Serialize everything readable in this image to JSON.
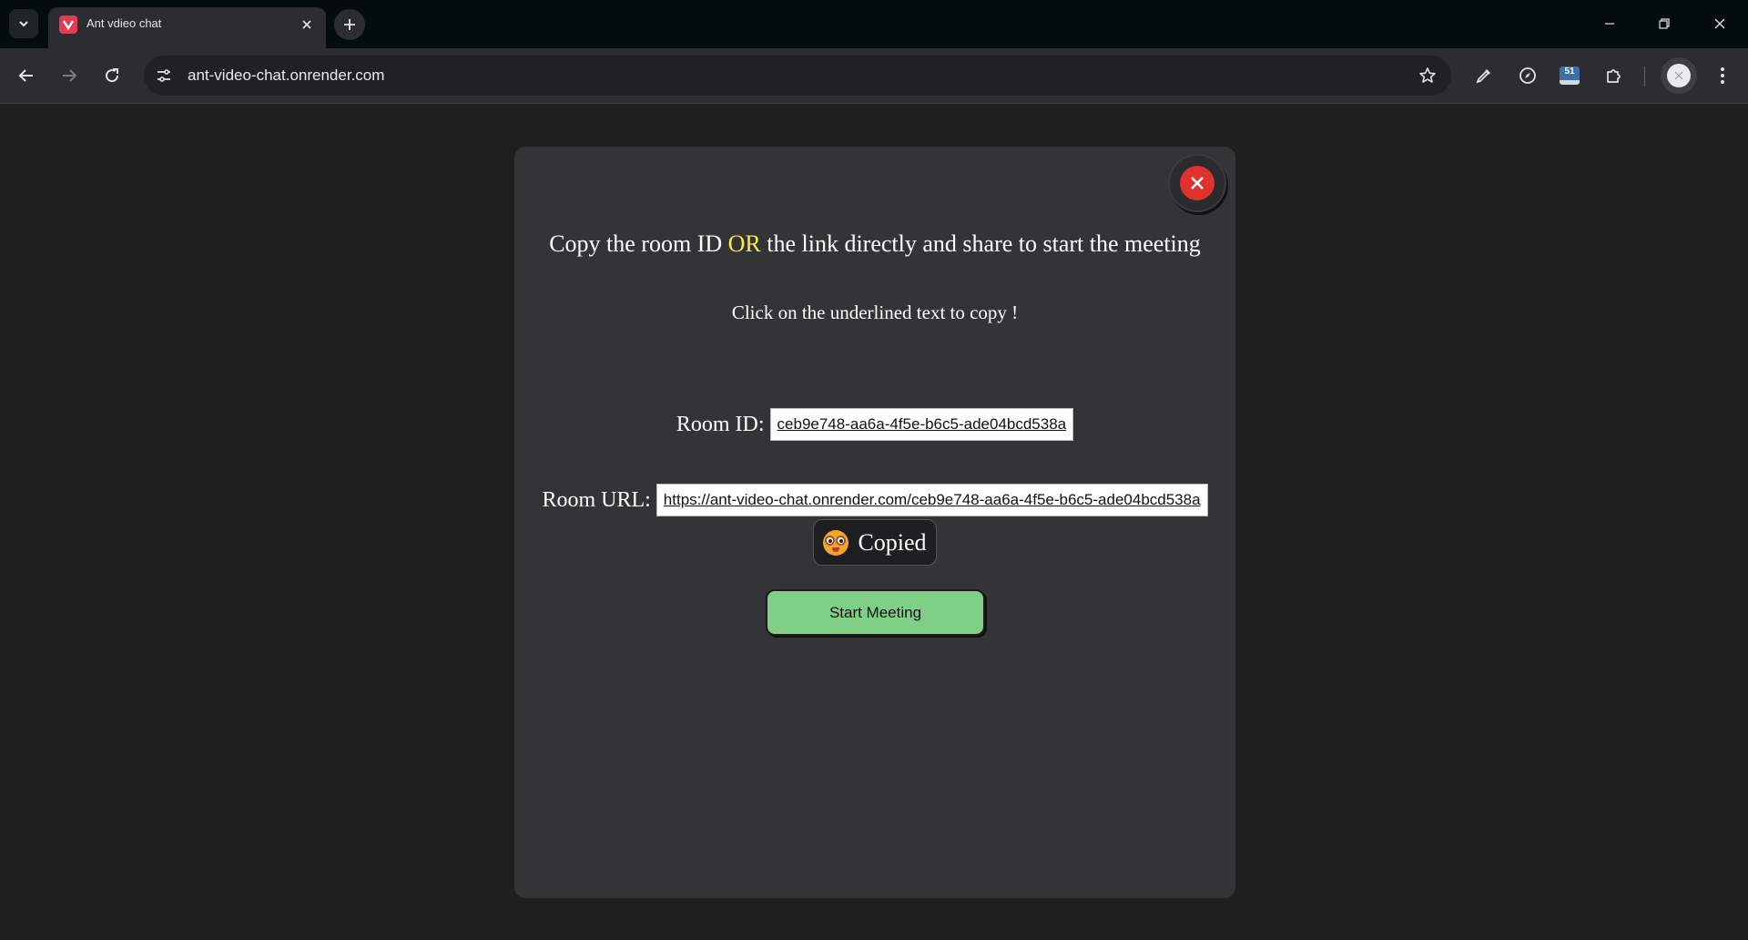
{
  "browser": {
    "tab_title": "Ant vdieo chat",
    "url": "ant-video-chat.onrender.com",
    "extension_badge": "51"
  },
  "modal": {
    "heading_part1": "Copy the room ID ",
    "heading_or": "OR",
    "heading_part2": " the link directly and share to start the meeting",
    "hint": "Click on the underlined text to copy !",
    "room_id_label": "Room ID:",
    "room_id_value": "ceb9e748-aa6a-4f5e-b6c5-ade04bcd538a",
    "room_url_label": "Room URL:",
    "room_url_value": "https://ant-video-chat.onrender.com/ceb9e748-aa6a-4f5e-b6c5-ade04bcd538a",
    "copied_label": "Copied",
    "start_button": "Start Meeting"
  },
  "colors": {
    "accent_or": "#ffeb3b",
    "close_button": "#e0312c",
    "start_button": "#7fcf86",
    "modal_bg": "#333436",
    "page_bg": "#1f1f1f"
  },
  "icons": {
    "close": "close-icon",
    "copied_emoji": "wide-eyed-face-icon"
  }
}
